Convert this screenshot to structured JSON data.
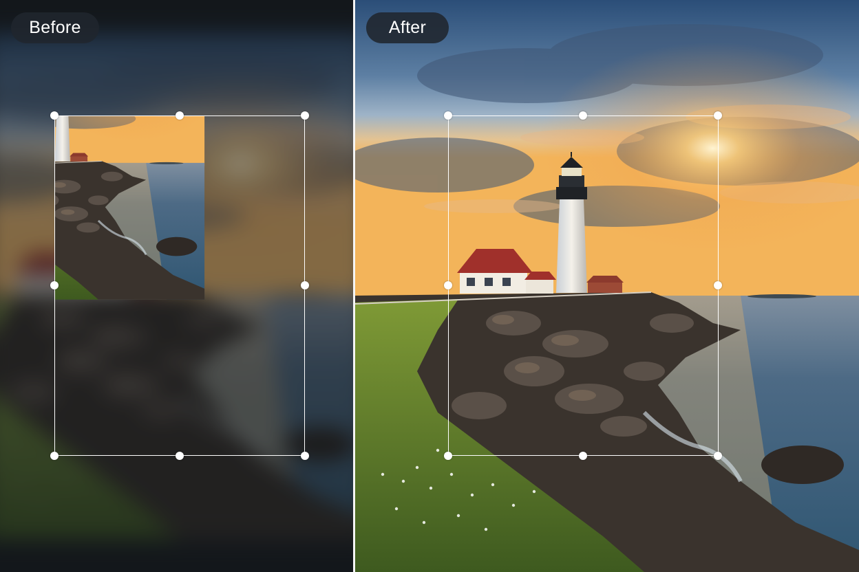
{
  "labels": {
    "before": "Before",
    "after": "After"
  },
  "icons": {
    "crop_handle": "circle-handle"
  },
  "colors": {
    "badge_bg": "#20262d",
    "badge_text": "#ffffff",
    "crop_frame": "#ffffff",
    "divider": "#f5f5f5",
    "sky_top": "#2b4e78",
    "sunset": "#f3b45a",
    "sea": "#3f6583",
    "rock": "#3a332d",
    "grass": "#6f8a2e"
  }
}
